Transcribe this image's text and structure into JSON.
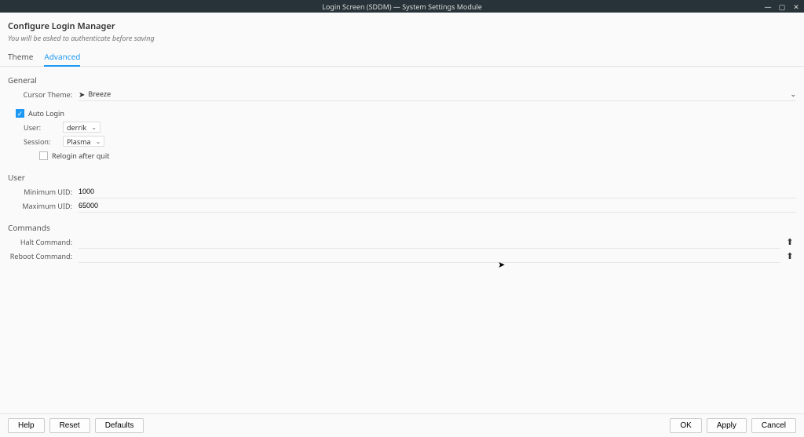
{
  "window": {
    "title": "Login Screen (SDDM) — System Settings Module"
  },
  "header": {
    "title": "Configure Login Manager",
    "subtitle": "You will be asked to authenticate before saving"
  },
  "tabs": {
    "theme": "Theme",
    "advanced": "Advanced"
  },
  "sections": {
    "general": "General",
    "user": "User",
    "commands": "Commands"
  },
  "general": {
    "cursor_theme_label": "Cursor Theme:",
    "cursor_theme_value": "Breeze",
    "auto_login_label": "Auto Login",
    "auto_login_checked": true,
    "user_label": "User:",
    "user_value": "derrik",
    "session_label": "Session:",
    "session_value": "Plasma",
    "relogin_label": "Relogin after quit",
    "relogin_checked": false
  },
  "user": {
    "minimum_uid_label": "Minimum UID:",
    "minimum_uid_value": "1000",
    "maximum_uid_label": "Maximum UID:",
    "maximum_uid_value": "65000"
  },
  "commands": {
    "halt_label": "Halt Command:",
    "halt_value": "",
    "reboot_label": "Reboot Command:",
    "reboot_value": ""
  },
  "footer": {
    "help": "Help",
    "reset": "Reset",
    "defaults": "Defaults",
    "ok": "OK",
    "apply": "Apply",
    "cancel": "Cancel"
  }
}
